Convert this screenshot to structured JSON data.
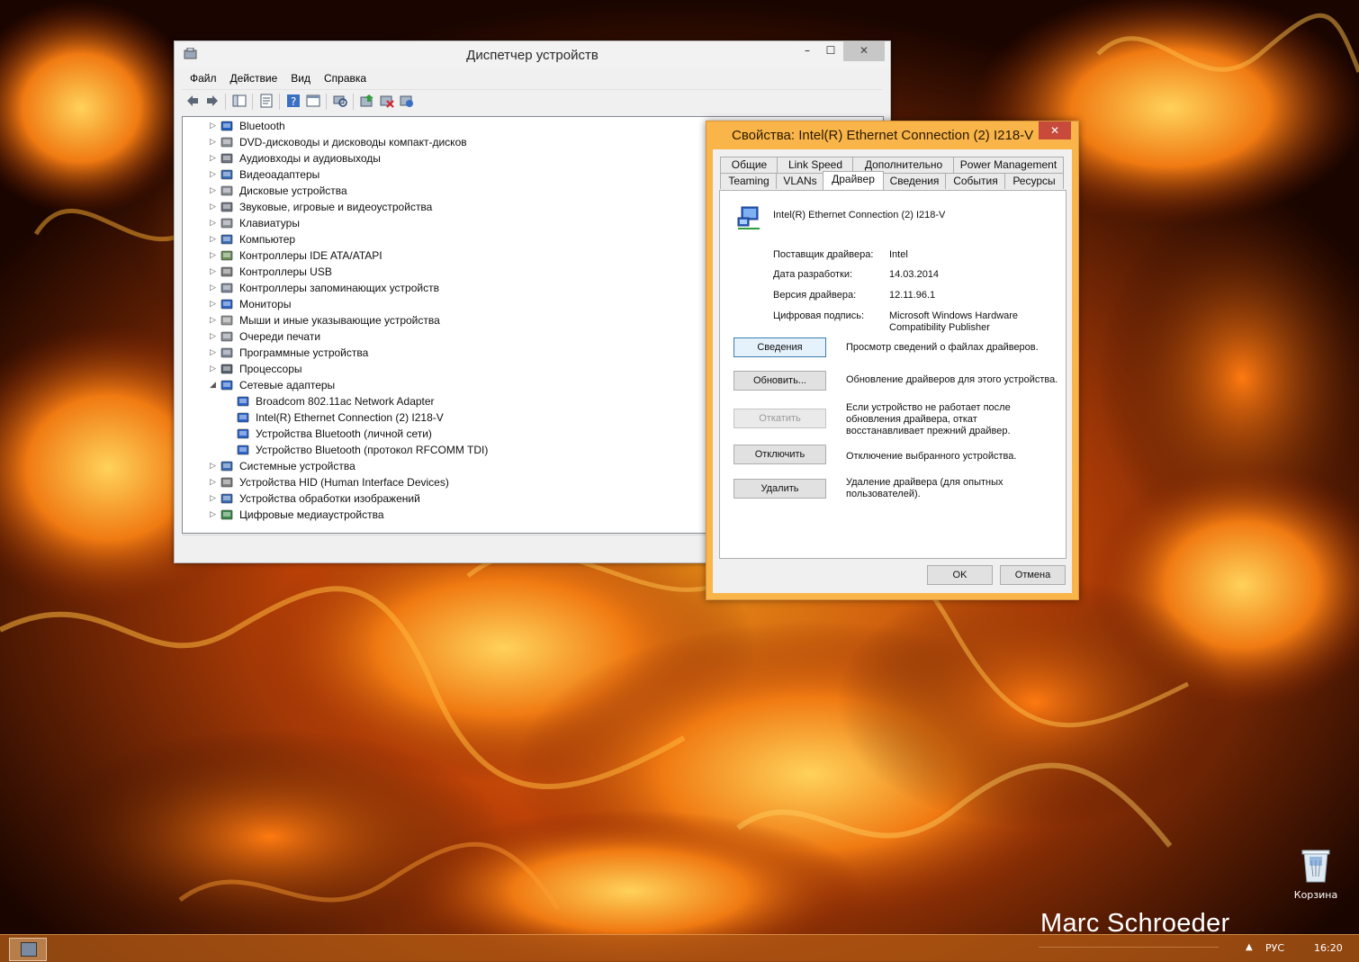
{
  "desktop": {
    "watermark": "Marc Schroeder",
    "recycle_bin_label": "Корзина"
  },
  "taskbar": {
    "language": "РУС",
    "clock": "16:20",
    "tray_arrow": "▲"
  },
  "device_manager": {
    "title": "Диспетчер устройств",
    "window_buttons": {
      "minimize": "–",
      "maximize": "☐",
      "close": "✕"
    },
    "menu": [
      "Файл",
      "Действие",
      "Вид",
      "Справка"
    ],
    "toolbar_icons": [
      "back-icon",
      "forward-icon",
      "show-hide-tree-icon",
      "properties-icon",
      "help-icon",
      "view-icon",
      "scan-hardware-icon",
      "update-driver-icon",
      "disable-device-icon",
      "uninstall-device-icon"
    ],
    "tree": [
      {
        "label": "Bluetooth",
        "expanded": false,
        "icon": "bluetooth-icon"
      },
      {
        "label": "DVD-дисководы и дисководы компакт-дисков",
        "expanded": false,
        "icon": "dvd-drive-icon"
      },
      {
        "label": "Аудиовходы и аудиовыходы",
        "expanded": false,
        "icon": "speaker-icon"
      },
      {
        "label": "Видеоадаптеры",
        "expanded": false,
        "icon": "display-adapter-icon"
      },
      {
        "label": "Дисковые устройства",
        "expanded": false,
        "icon": "disk-drive-icon"
      },
      {
        "label": "Звуковые, игровые и видеоустройства",
        "expanded": false,
        "icon": "sound-icon"
      },
      {
        "label": "Клавиатуры",
        "expanded": false,
        "icon": "keyboard-icon"
      },
      {
        "label": "Компьютер",
        "expanded": false,
        "icon": "computer-icon"
      },
      {
        "label": "Контроллеры IDE ATA/ATAPI",
        "expanded": false,
        "icon": "ide-controller-icon"
      },
      {
        "label": "Контроллеры USB",
        "expanded": false,
        "icon": "usb-icon"
      },
      {
        "label": "Контроллеры запоминающих устройств",
        "expanded": false,
        "icon": "storage-controller-icon"
      },
      {
        "label": "Мониторы",
        "expanded": false,
        "icon": "monitor-icon"
      },
      {
        "label": "Мыши и иные указывающие устройства",
        "expanded": false,
        "icon": "mouse-icon"
      },
      {
        "label": "Очереди печати",
        "expanded": false,
        "icon": "printer-icon"
      },
      {
        "label": "Программные устройства",
        "expanded": false,
        "icon": "software-device-icon"
      },
      {
        "label": "Процессоры",
        "expanded": false,
        "icon": "processor-icon"
      },
      {
        "label": "Сетевые адаптеры",
        "expanded": true,
        "icon": "network-adapter-icon"
      },
      {
        "label": "Broadcom 802.11ac Network Adapter",
        "child": true,
        "icon": "network-adapter-icon"
      },
      {
        "label": "Intel(R) Ethernet Connection (2) I218-V",
        "child": true,
        "icon": "network-adapter-icon"
      },
      {
        "label": "Устройства Bluetooth (личной сети)",
        "child": true,
        "icon": "network-adapter-icon"
      },
      {
        "label": "Устройство Bluetooth (протокол RFCOMM TDI)",
        "child": true,
        "icon": "network-adapter-icon"
      },
      {
        "label": "Системные устройства",
        "expanded": false,
        "icon": "system-device-icon"
      },
      {
        "label": "Устройства HID (Human Interface Devices)",
        "expanded": false,
        "icon": "hid-icon"
      },
      {
        "label": "Устройства обработки изображений",
        "expanded": false,
        "icon": "imaging-device-icon"
      },
      {
        "label": "Цифровые медиаустройства",
        "expanded": false,
        "icon": "media-device-icon"
      }
    ]
  },
  "properties": {
    "title": "Свойства: Intel(R) Ethernet Connection (2) I218-V",
    "close": "✕",
    "tabs_row1": [
      "Общие",
      "Link Speed",
      "Дополнительно",
      "Power Management"
    ],
    "tabs_row2": [
      "Teaming",
      "VLANs",
      "Драйвер",
      "Сведения",
      "События",
      "Ресурсы"
    ],
    "active_tab": "Драйвер",
    "device_name": "Intel(R) Ethernet Connection (2) I218-V",
    "fields": [
      {
        "label": "Поставщик драйвера:",
        "value": "Intel"
      },
      {
        "label": "Дата разработки:",
        "value": "14.03.2014"
      },
      {
        "label": "Версия драйвера:",
        "value": "12.11.96.1"
      },
      {
        "label": "Цифровая подпись:",
        "value": "Microsoft Windows Hardware Compatibility Publisher"
      }
    ],
    "actions": [
      {
        "button": "Сведения",
        "description": "Просмотр сведений о файлах драйверов."
      },
      {
        "button": "Обновить...",
        "description": "Обновление драйверов для этого устройства."
      },
      {
        "button": "Откатить",
        "description": "Если устройство не работает после обновления драйвера, откат восстанавливает прежний драйвер.",
        "disabled": true
      },
      {
        "button": "Отключить",
        "description": "Отключение выбранного устройства."
      },
      {
        "button": "Удалить",
        "description": "Удаление драйвера (для опытных пользователей)."
      }
    ],
    "ok": "OK",
    "cancel": "Отмена"
  }
}
